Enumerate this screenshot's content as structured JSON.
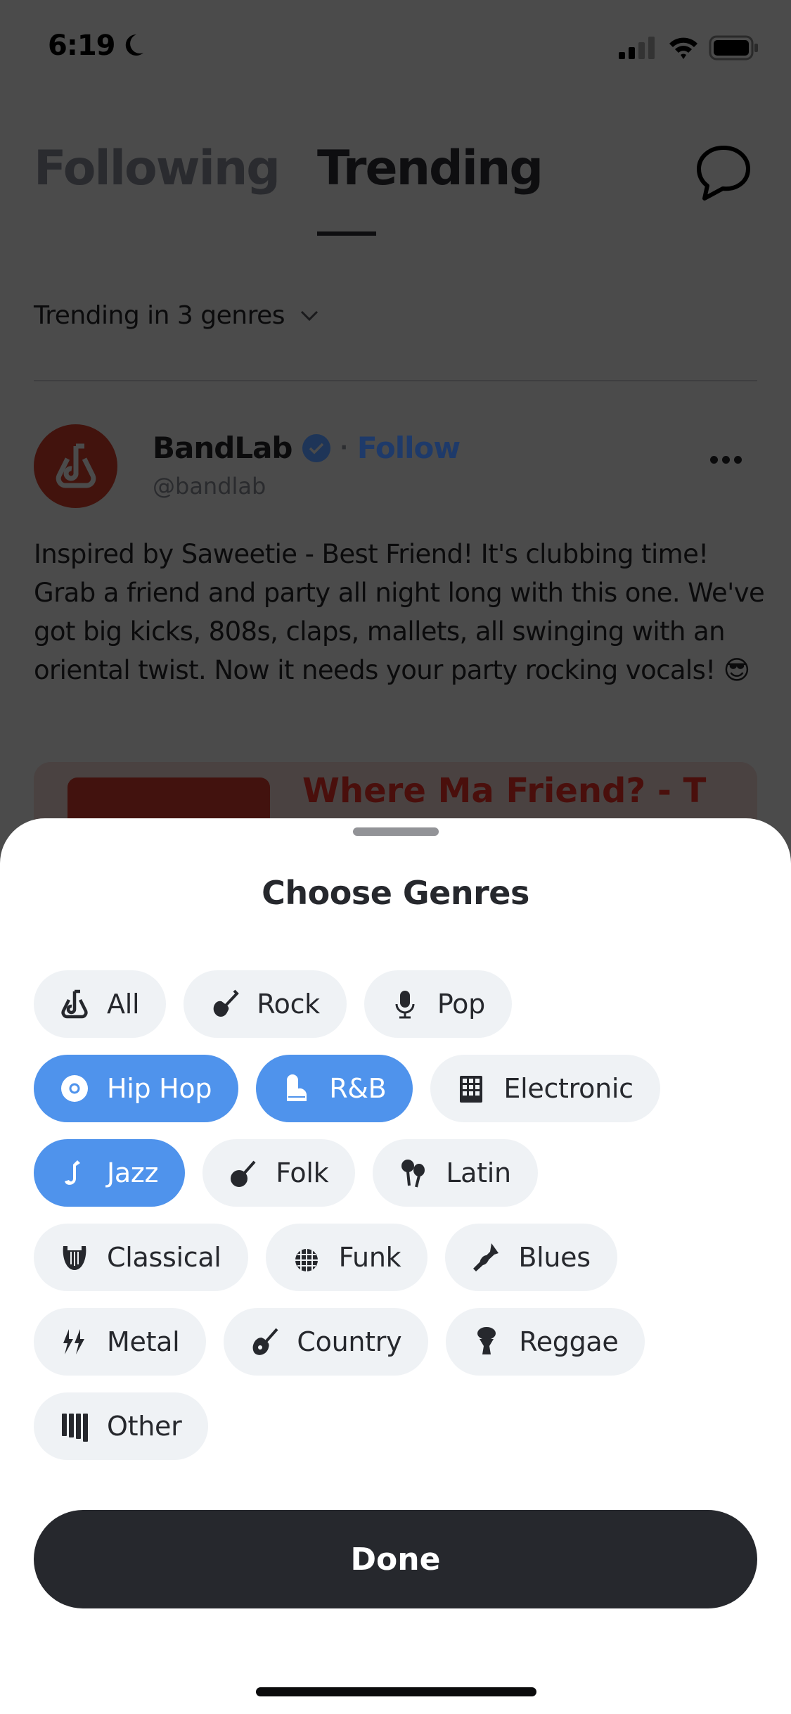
{
  "status_bar": {
    "time": "6:19",
    "icons": [
      "moon-icon",
      "signal-icon",
      "wifi-icon",
      "battery-icon"
    ]
  },
  "header": {
    "tabs": [
      {
        "label": "Following",
        "active": false
      },
      {
        "label": "Trending",
        "active": true
      }
    ],
    "chat_icon": "chat-bubble-icon"
  },
  "filter": {
    "label": "Trending in 3 genres",
    "icon": "chevron-down-icon"
  },
  "post": {
    "author": "BandLab",
    "handle": "@bandlab",
    "follow_label": "Follow",
    "separator": "·",
    "body": "Inspired by Saweetie - Best Friend! It's clubbing time! Grab a friend and party all night long with this one. We've got big kicks, 808s, claps, mallets, all swinging with an oriental twist. Now it needs your party rocking vocals! 😎",
    "card_title": "Where Ma Friend? - T"
  },
  "sheet": {
    "title": "Choose Genres",
    "genres": [
      {
        "label": "All",
        "icon": "bandlab-logo-icon",
        "selected": false
      },
      {
        "label": "Rock",
        "icon": "electric-guitar-icon",
        "selected": false
      },
      {
        "label": "Pop",
        "icon": "microphone-icon",
        "selected": false
      },
      {
        "label": "Hip Hop",
        "icon": "vinyl-disc-icon",
        "selected": true
      },
      {
        "label": "R&B",
        "icon": "piano-icon",
        "selected": true
      },
      {
        "label": "Electronic",
        "icon": "drum-pad-icon",
        "selected": false
      },
      {
        "label": "Jazz",
        "icon": "saxophone-icon",
        "selected": true
      },
      {
        "label": "Folk",
        "icon": "banjo-icon",
        "selected": false
      },
      {
        "label": "Latin",
        "icon": "maracas-icon",
        "selected": false
      },
      {
        "label": "Classical",
        "icon": "lyre-icon",
        "selected": false
      },
      {
        "label": "Funk",
        "icon": "disco-ball-icon",
        "selected": false
      },
      {
        "label": "Blues",
        "icon": "trumpet-icon",
        "selected": false
      },
      {
        "label": "Metal",
        "icon": "lightning-icon",
        "selected": false
      },
      {
        "label": "Country",
        "icon": "acoustic-guitar-icon",
        "selected": false
      },
      {
        "label": "Reggae",
        "icon": "djembe-icon",
        "selected": false
      },
      {
        "label": "Other",
        "icon": "xylophone-icon",
        "selected": false
      }
    ],
    "done_label": "Done"
  },
  "colors": {
    "selected": "#4f93ec",
    "chip": "#eff2f5",
    "text": "#26282d",
    "button": "#26282d",
    "brand": "#e1331f",
    "link": "#2f6fe0"
  }
}
